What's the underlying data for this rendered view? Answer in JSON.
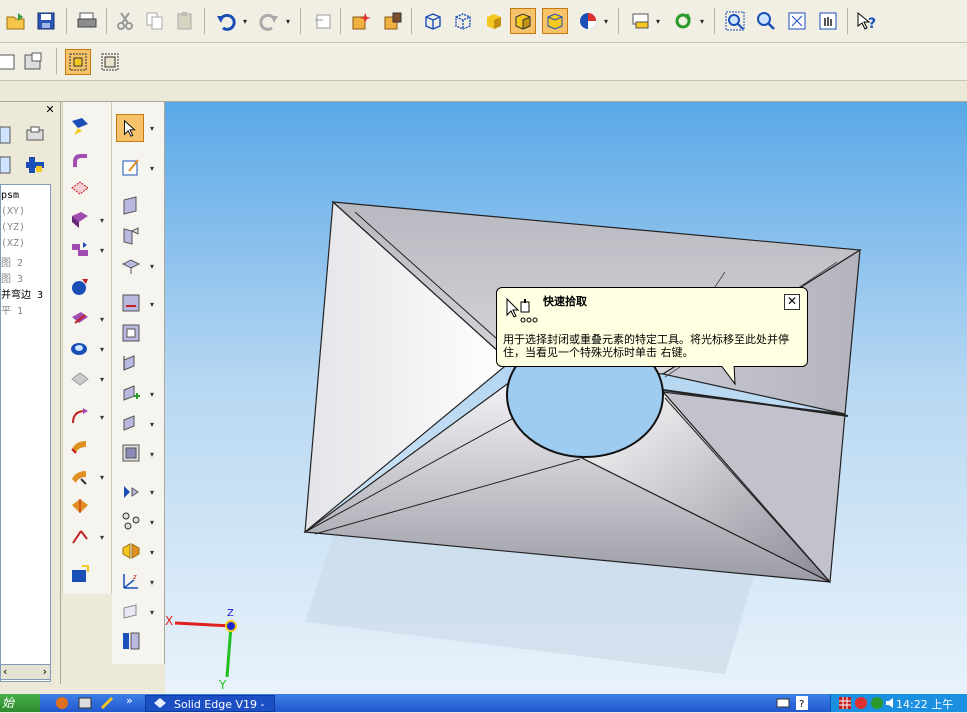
{
  "tooltip": {
    "title": "快速拾取",
    "body": "用于选择封闭或重叠元素的特定工具。将光标移至此处并停住，当看见一个特殊光标时单击 右键。",
    "close": "✕"
  },
  "tree": {
    "items": [
      {
        "label": "psm",
        "dim": false
      },
      {
        "label": "(XY)",
        "dim": true
      },
      {
        "label": "(YZ)",
        "dim": true
      },
      {
        "label": "(XZ)",
        "dim": true
      },
      {
        "label": "图 2",
        "dim": true
      },
      {
        "label": "图 3",
        "dim": true
      },
      {
        "label": "并弯边 3",
        "dim": false
      },
      {
        "label": "平 1",
        "dim": true
      }
    ],
    "close_label": "✕",
    "scroll_left": "‹",
    "scroll_right": "›"
  },
  "axes": {
    "x": "X",
    "y": "Y",
    "z": "Z"
  },
  "taskbar": {
    "start_label": "始",
    "task_title": "Solid Edge V19 -",
    "clock": "14:22 上午",
    "quicklaunch_more": "»"
  },
  "toolbar_icons": [
    "open-icon",
    "save-icon",
    "print-icon",
    "cut-icon",
    "copy-icon",
    "paste-icon",
    "undo-icon",
    "redo-icon",
    "new-window-icon",
    "zone-icon",
    "select-zone-icon",
    "wireframe-icon",
    "hidden-edge-icon",
    "shaded-icon",
    "shaded-edges-icon",
    "smooth-shaded-icon",
    "render-icon",
    "view-manager-icon",
    "rotate-icon",
    "zoom-area-icon",
    "zoom-icon",
    "fit-icon",
    "pan-icon",
    "whats-this-icon"
  ],
  "colors": {
    "viewport_top": "#5aa8e8",
    "viewport_bottom": "#e9f2fa",
    "tooltip_bg": "#ffffe1",
    "active_btn": "#f6c36b",
    "taskbar": "#2358cf",
    "axis_x": "#e02020",
    "axis_y": "#20c020",
    "axis_z": "#2020e0"
  }
}
